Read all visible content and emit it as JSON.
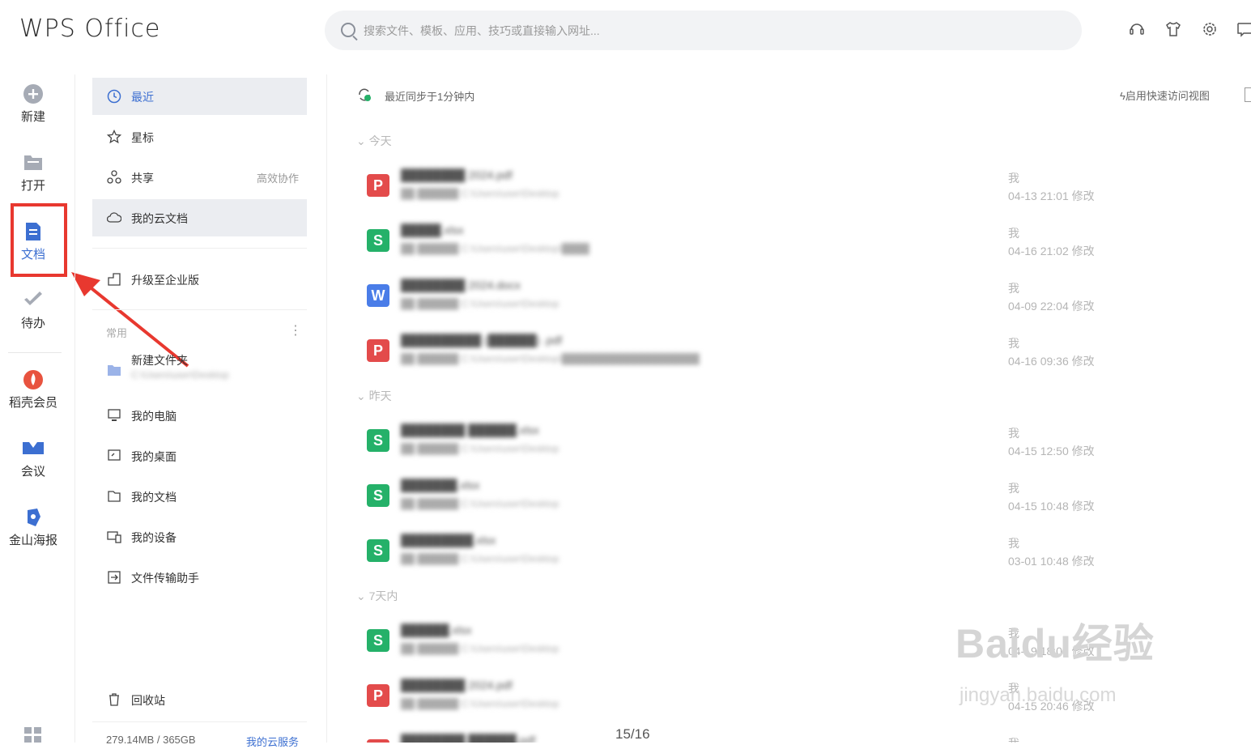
{
  "app": {
    "title": "WPS Office"
  },
  "search": {
    "placeholder": "搜索文件、模板、应用、技巧或直接输入网址..."
  },
  "rail": {
    "new": "新建",
    "open": "打开",
    "docs": "文档",
    "todo": "待办",
    "member": "稻壳会员",
    "meeting": "会议",
    "poster": "金山海报"
  },
  "nav": {
    "recent": "最近",
    "starred": "星标",
    "shared": "共享",
    "shared_tag": "高效协作",
    "cloud": "我的云文档",
    "upgrade": "升级至企业版",
    "common_header": "常用",
    "new_folder": "新建文件夹",
    "my_pc": "我的电脑",
    "my_desktop": "我的桌面",
    "my_docs": "我的文档",
    "my_devices": "我的设备",
    "transfer": "文件传输助手",
    "recycle": "回收站",
    "storage": "279.14MB / 365GB",
    "service": "我的云服务"
  },
  "main": {
    "sync_status": "最近同步于1分钟内",
    "quick_view": "启用快速访问视图",
    "groups": [
      {
        "label": "今天"
      },
      {
        "label": "昨天"
      },
      {
        "label": "7天内"
      }
    ],
    "files": [
      {
        "type": "pdf",
        "owner": "我",
        "time": "04-13 21:01 修改"
      },
      {
        "type": "xls",
        "owner": "我",
        "time": "04-16 21:02 修改"
      },
      {
        "type": "doc",
        "owner": "我",
        "time": "04-09 22:04 修改"
      },
      {
        "type": "pdf",
        "owner": "我",
        "time": "04-16 09:36 修改"
      },
      {
        "type": "xls",
        "owner": "我",
        "time": "04-15 12:50 修改"
      },
      {
        "type": "xls",
        "owner": "我",
        "time": "04-15 10:48 修改"
      },
      {
        "type": "xls",
        "owner": "我",
        "time": "03-01 10:48 修改"
      },
      {
        "type": "xls",
        "owner": "我",
        "time": "04-19 18:08 修改"
      },
      {
        "type": "pdf",
        "owner": "我",
        "time": "04-15 20:46 修改"
      },
      {
        "type": "pdf",
        "owner": "我",
        "time": ""
      }
    ]
  },
  "page_counter": "15/16",
  "watermark": {
    "brand": "Baidu经验",
    "url": "jingyan.baidu.com"
  },
  "colors": {
    "accent": "#3c6fd1",
    "highlight": "#e8382f",
    "pdf": "#e34b4b",
    "xls": "#25b169",
    "doc": "#4a7de8"
  }
}
